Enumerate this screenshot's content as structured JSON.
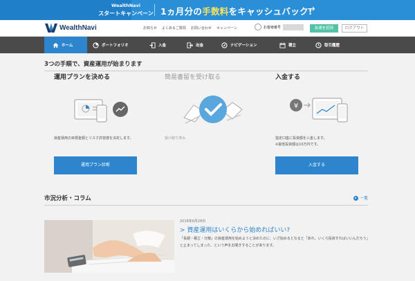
{
  "banner": {
    "line1": "WealthNavi",
    "line2": "スタートキャンペーン",
    "headline_pre": "1ヵ月分の",
    "headline_highlight": "手数料",
    "headline_post": "をキャッシュバック!",
    "arrow": "→"
  },
  "header": {
    "logo_text": "WealthNavi",
    "links": [
      "お知らせ",
      "よくあるご質問",
      "お問い合わせ",
      "キャンペーン"
    ],
    "user_label": "お客様番号",
    "invite_button": "友達を招待",
    "logout_button": "ログアウト"
  },
  "nav": {
    "items": [
      {
        "label": "ホーム",
        "icon": "home-icon"
      },
      {
        "label": "ポートフォリオ",
        "icon": "portfolio-icon"
      },
      {
        "label": "入金",
        "icon": "deposit-icon"
      },
      {
        "label": "出金",
        "icon": "withdraw-icon"
      },
      {
        "label": "ナビゲーション",
        "icon": "navigation-icon"
      },
      {
        "label": "積立",
        "icon": "recurring-icon"
      },
      {
        "label": "取引履歴",
        "icon": "history-icon"
      }
    ]
  },
  "main": {
    "title": "3つの手順で、資産運用が始まります",
    "steps": [
      {
        "title": "運用プランを決める",
        "desc": "資産運用の目標金額とリスク許容度を決定します。",
        "button": "運用プラン診断"
      },
      {
        "title": "簡易書留を受け取る",
        "desc": "受け取り済み"
      },
      {
        "title": "入金する",
        "desc_line1": "指定口座に投資額を入金します。",
        "desc_line2": "※最低投資額は10万円です。",
        "button": "入金する"
      }
    ],
    "column": {
      "title": "市況分析・コラム",
      "more": "一覧",
      "article": {
        "date": "2018年6月28日",
        "title": "> 資産運用はいくらから始めればいい?",
        "excerpt": "「長期・積立・分散」の資産運用を始めようと決めたのに、いざ始めるとなると「あれ、いくら投資すればいいんだろう」と止まってしまった、という声をお聞きすることがあります。"
      }
    }
  },
  "colors": {
    "accent": "#2d85cd",
    "nav_bg": "#4a4a4a",
    "invite": "#53c2a6",
    "banner_highlight": "#ffe35a"
  }
}
